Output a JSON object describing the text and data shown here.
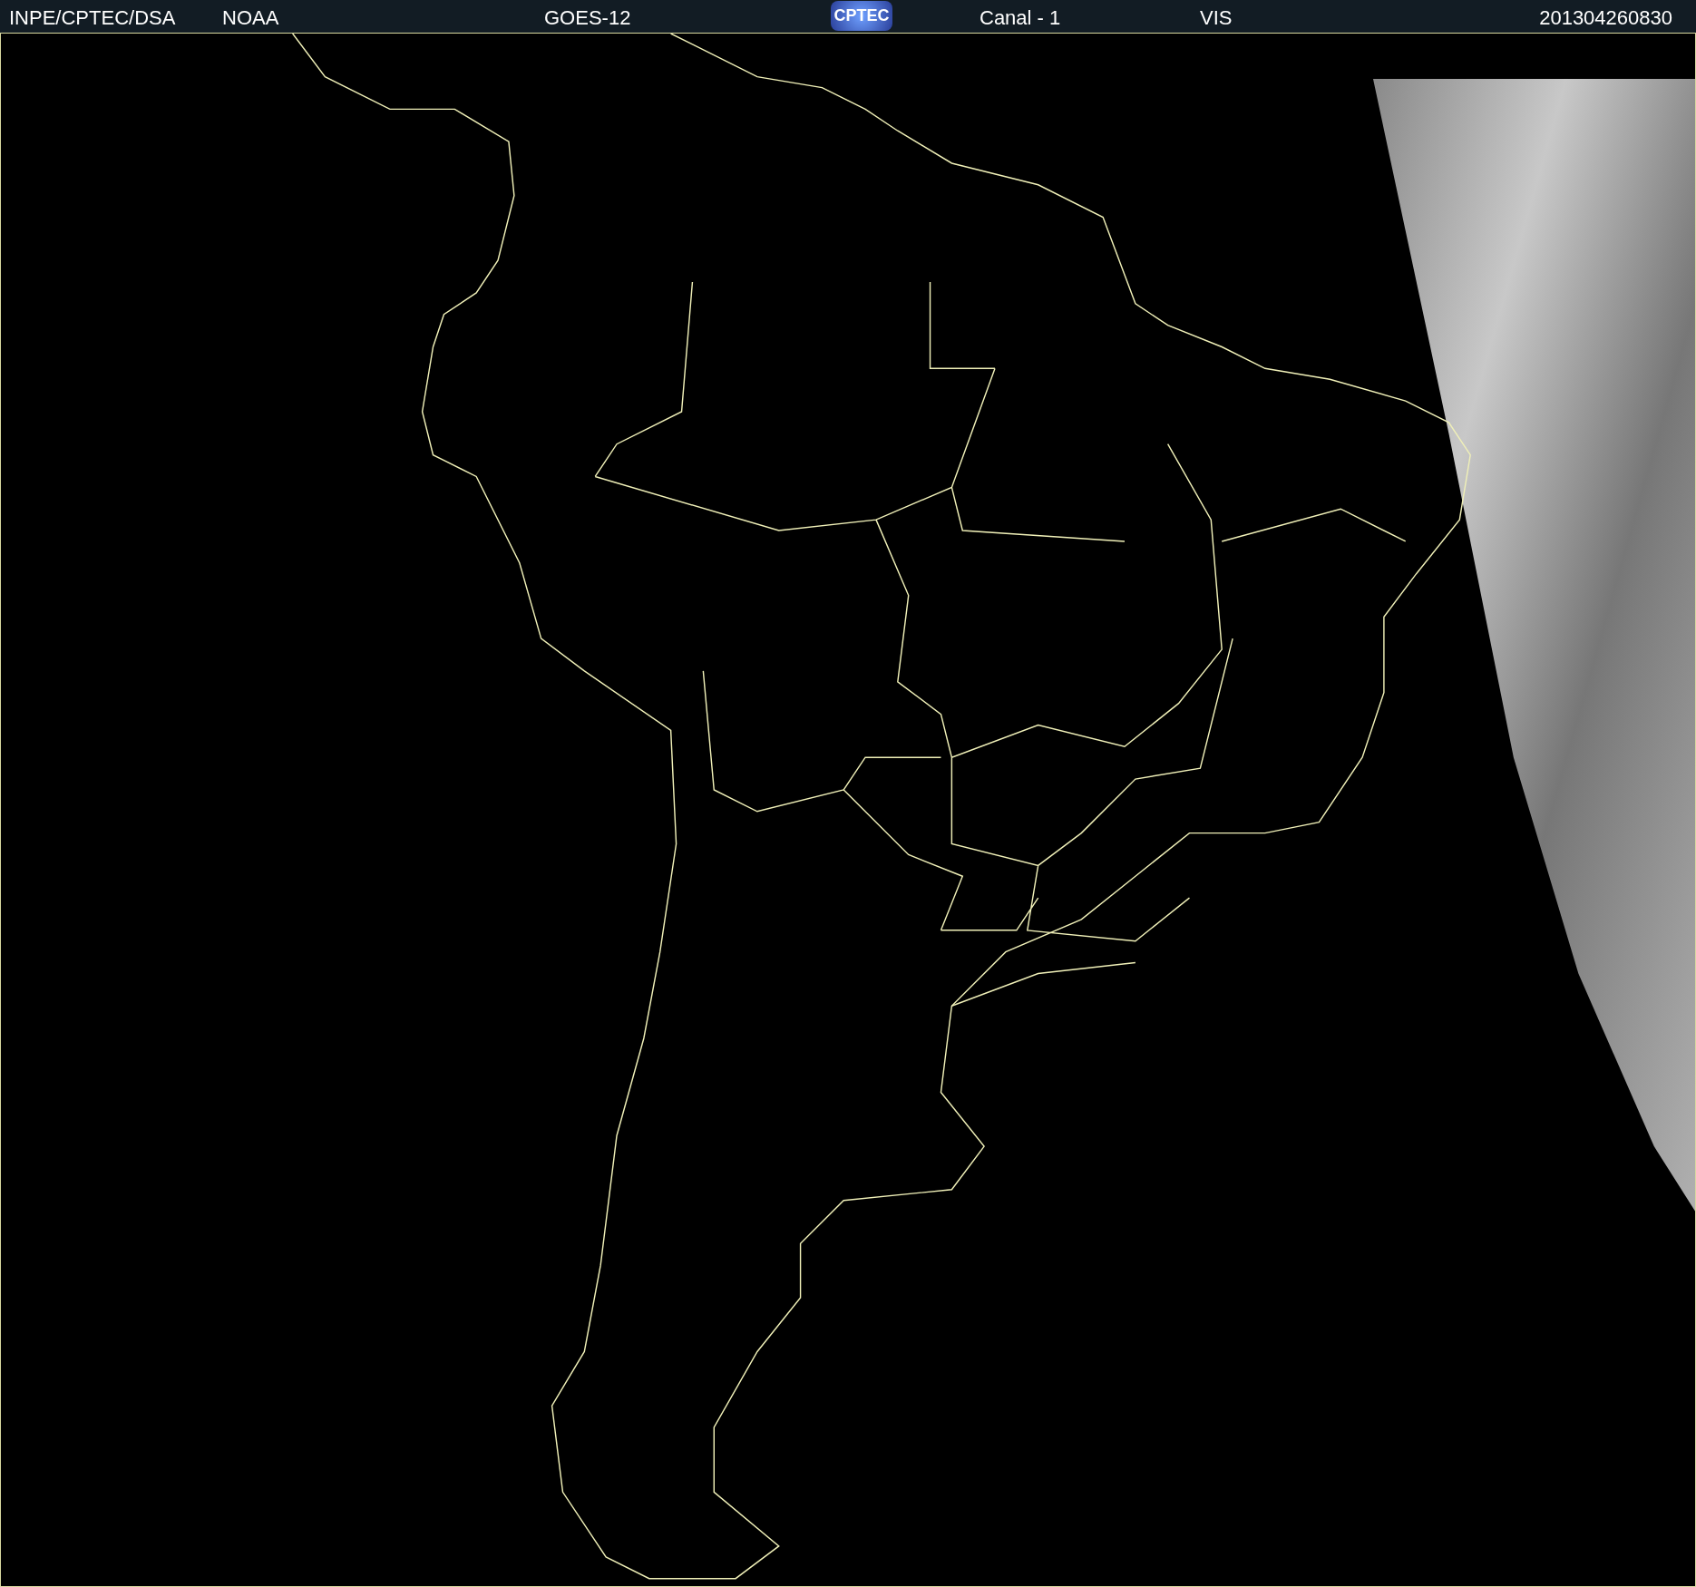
{
  "header": {
    "source": "INPE/CPTEC/DSA",
    "agency": "NOAA",
    "satellite": "GOES-12",
    "logo": "CPTEC",
    "channel": "Canal - 1",
    "band": "VIS",
    "timestamp": "201304260830"
  }
}
